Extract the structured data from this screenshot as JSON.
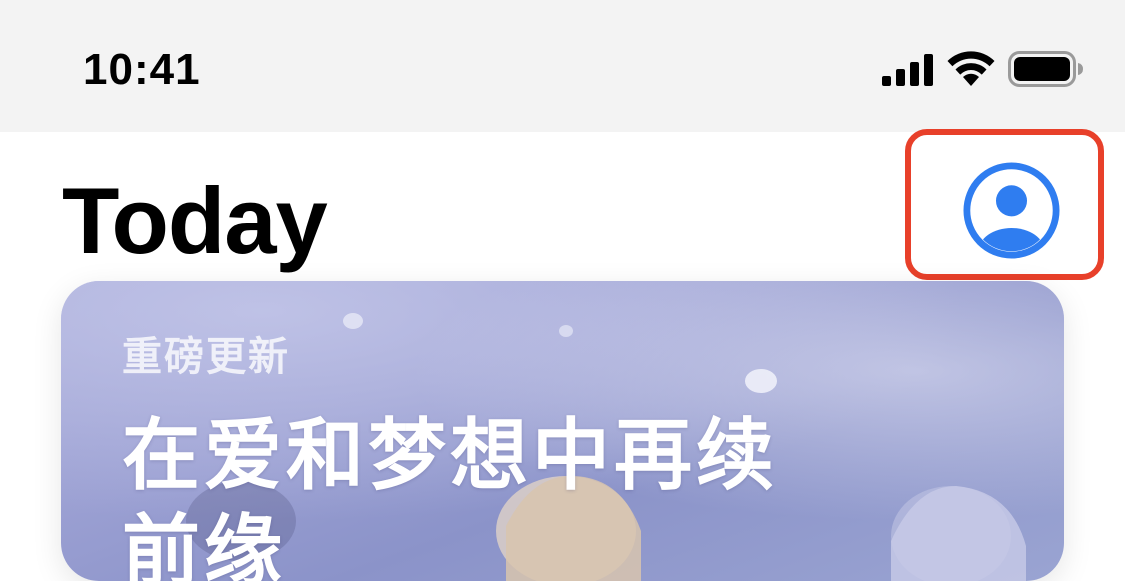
{
  "status_bar": {
    "time": "10:41",
    "icons": [
      "signal-icon",
      "wifi-icon",
      "battery-icon"
    ]
  },
  "header": {
    "title": "Today",
    "account_icon": "account-circle-icon"
  },
  "featured_card": {
    "eyebrow": "重磅更新",
    "title": "在爱和梦想中再续前缘"
  },
  "colors": {
    "accent": "#2f7df0",
    "highlight": "#e8402a",
    "status_bar_bg": "#f3f3f3"
  }
}
